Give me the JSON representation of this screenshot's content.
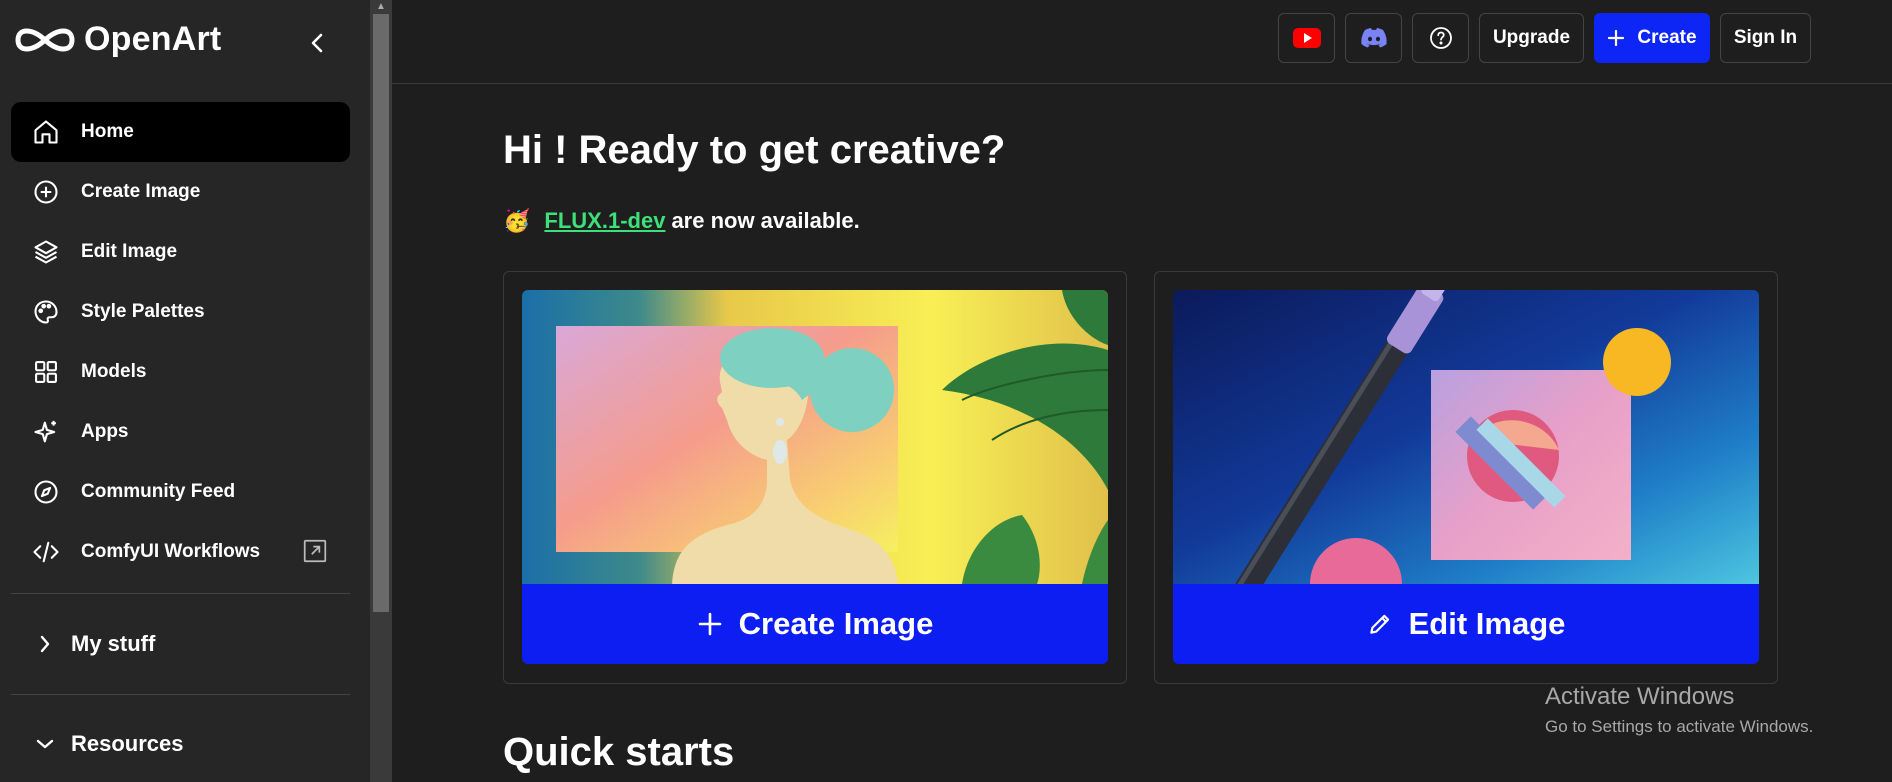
{
  "app": {
    "logo_text": "OpenArt"
  },
  "sidebar": {
    "items": [
      {
        "label": "Home",
        "icon": "home-icon",
        "active": true
      },
      {
        "label": "Create Image",
        "icon": "plus-circle-icon"
      },
      {
        "label": "Edit Image",
        "icon": "layers-icon"
      },
      {
        "label": "Style Palettes",
        "icon": "palette-icon"
      },
      {
        "label": "Models",
        "icon": "grid-icon"
      },
      {
        "label": "Apps",
        "icon": "sparkle-icon"
      },
      {
        "label": "Community Feed",
        "icon": "compass-icon"
      },
      {
        "label": "ComfyUI Workflows",
        "icon": "code-icon",
        "external": true
      }
    ],
    "sections": [
      {
        "label": "My stuff",
        "expanded": false
      },
      {
        "label": "Resources",
        "expanded": true
      }
    ]
  },
  "header": {
    "upgrade_label": "Upgrade",
    "create_label": "Create",
    "signin_label": "Sign In",
    "icons": [
      "youtube-icon",
      "discord-icon",
      "help-icon"
    ]
  },
  "main": {
    "greeting": "Hi ! Ready to get creative?",
    "announcement": {
      "emoji": "🥳",
      "link_text": "FLUX.1-dev",
      "text": "are now available."
    },
    "cards": [
      {
        "label": "Create Image",
        "icon": "plus-icon"
      },
      {
        "label": "Edit Image",
        "icon": "pencil-icon"
      }
    ],
    "quick_starts_title": "Quick starts"
  },
  "watermark": {
    "line1": "Activate Windows",
    "line2": "Go to Settings to activate Windows."
  },
  "colors": {
    "accent": "#0d26f5",
    "link": "#3ee07a",
    "bg": "#1e1e1e",
    "sidebar": "#262626"
  }
}
